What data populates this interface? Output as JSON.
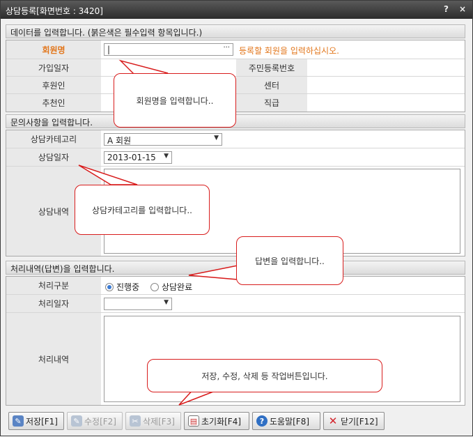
{
  "window": {
    "title": "상담등록[화면번호 : 3420]",
    "help_glyph": "?",
    "close_glyph": "×"
  },
  "member_section": {
    "heading": "데이터를 입력합니다. (붉은색은 필수입력 항목입니다.)",
    "name_label": "회원명",
    "name_value": "|",
    "lookup_glyph": "···",
    "name_hint": "등록할 회원을 입력하십시오.",
    "join_date_label": "가입일자",
    "resident_no_label": "주민등록번호",
    "sponsor_label": "후원인",
    "center_label": "센터",
    "recommender_label": "추천인",
    "position_label": "직급"
  },
  "inquiry_section": {
    "heading": "문의사항을 입력합니다.",
    "category_label": "상담카테고리",
    "category_value": "A 회원",
    "date_label": "상담일자",
    "date_value": "2013-01-15",
    "content_label": "상담내역"
  },
  "process_section": {
    "heading": "처리내역(답변)을 입력합니다.",
    "type_label": "처리구분",
    "opt_in_progress": "진행중",
    "opt_done": "상담완료",
    "date_label": "처리일자",
    "content_label": "처리내역"
  },
  "bubbles": {
    "member": "회원명을 입력합니다..",
    "category": "상담카테고리를 입력합니다..",
    "answer": "답변을 입력합니다..",
    "buttons": "저장, 수정, 삭제 등 작업버튼입니다."
  },
  "toolbar": {
    "save": "저장[F1]",
    "edit": "수정[F2]",
    "delete": "삭제[F3]",
    "reset": "초기화[F4]",
    "help": "도움말[F8]",
    "close": "닫기[F12]"
  },
  "colors": {
    "required": "#e2761b",
    "bubble_border": "#d81c1c",
    "radio_selected": "#3b7bd3"
  }
}
